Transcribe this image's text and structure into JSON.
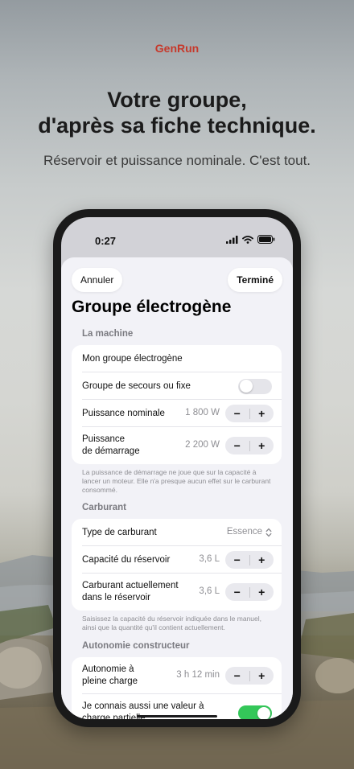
{
  "brand": "GenRun",
  "headline": {
    "line1": "Votre groupe,",
    "line2": "d'après sa fiche technique."
  },
  "subline": "Réservoir et puissance nominale. C'est tout.",
  "status_bar": {
    "time": "0:27"
  },
  "nav": {
    "cancel_label": "Annuler",
    "done_label": "Terminé"
  },
  "sheet_title": "Groupe électrogène",
  "sections": {
    "machine": {
      "header": "La machine",
      "name_value": "Mon groupe électrogène",
      "backup_label": "Groupe de secours ou fixe",
      "backup_toggle": false,
      "nominal_label": "Puissance nominale",
      "nominal_value": "1 800 W",
      "startup_label_1": "Puissance",
      "startup_label_2": "de démarrage",
      "startup_value": "2 200 W",
      "footnote": "La puissance de démarrage ne joue que sur la capacité à lancer un moteur. Elle n'a presque aucun effet sur le carburant consommé."
    },
    "fuel": {
      "header": "Carburant",
      "type_label": "Type de carburant",
      "type_value": "Essence",
      "capacity_label": "Capacité du réservoir",
      "capacity_value": "3,6 L",
      "current_label_1": "Carburant actuellement",
      "current_label_2": "dans le réservoir",
      "current_value": "3,6 L",
      "footnote": "Saisissez la capacité du réservoir indiquée dans le manuel, ainsi que la quantité qu'il contient actuellement."
    },
    "autonomy": {
      "header": "Autonomie constructeur",
      "full_label_1": "Autonomie à",
      "full_label_2": "pleine charge",
      "full_value": "3 h 12 min",
      "partial_label_1": "Je connais aussi une valeur à",
      "partial_label_2": "charge partielle",
      "partial_toggle": true
    }
  },
  "stepper": {
    "minus": "−",
    "plus": "+"
  },
  "icons": {
    "signal": "signal-icon",
    "wifi": "wifi-icon",
    "battery": "battery-icon",
    "chevron": "chevron-up-down-icon"
  },
  "colors": {
    "brand": "#c6392b",
    "toggle_on": "#34c759",
    "toggle_off": "#e5e5ea",
    "sheet_bg": "#f2f2f7"
  }
}
